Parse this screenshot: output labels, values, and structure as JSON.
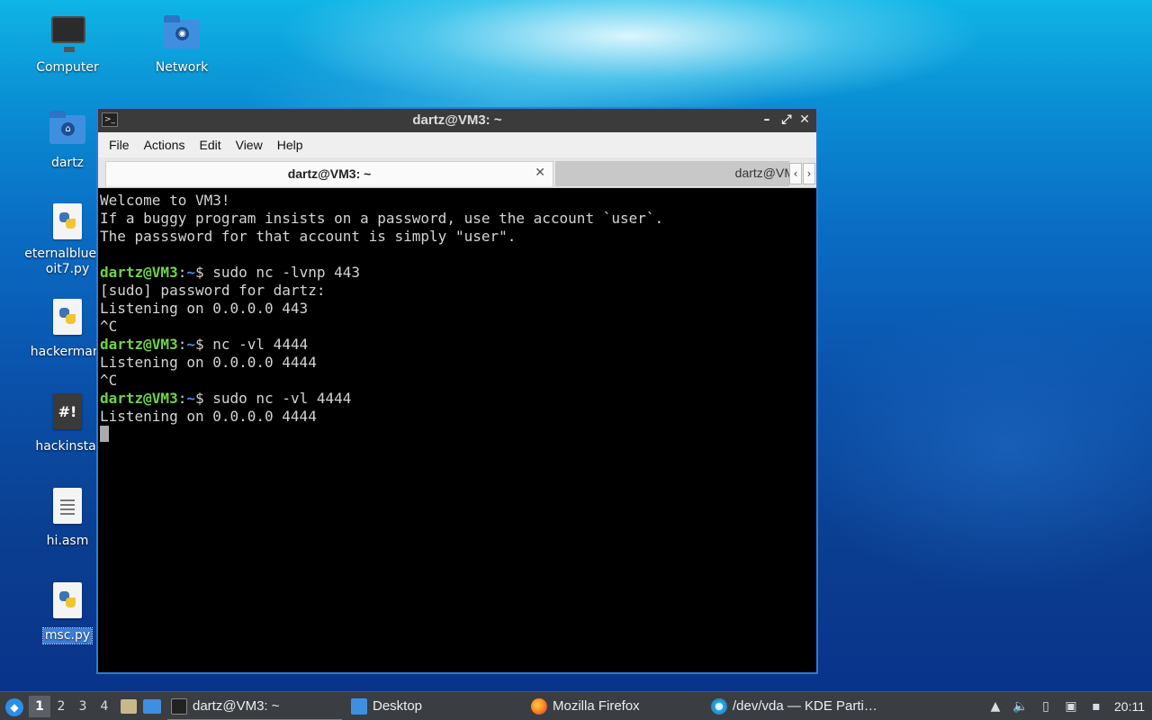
{
  "desktop": {
    "icons": [
      {
        "label": "Computer",
        "icon": "computer-icon"
      },
      {
        "label": "Network",
        "icon": "network-folder-icon"
      },
      {
        "label": "dartz",
        "icon": "home-folder-icon"
      },
      {
        "label": "eternalblue_e\noit7.py",
        "icon": "python-file-icon"
      },
      {
        "label": "hackerman.",
        "icon": "python-file-icon"
      },
      {
        "label": "hackinstal",
        "icon": "shell-script-icon"
      },
      {
        "label": "hi.asm",
        "icon": "text-file-icon"
      },
      {
        "label": "msc.py",
        "icon": "python-file-icon"
      }
    ]
  },
  "window": {
    "title": "dartz@VM3: ~",
    "menu": [
      "File",
      "Actions",
      "Edit",
      "View",
      "Help"
    ],
    "tabs": [
      {
        "label": "dartz@VM3: ~",
        "active": true
      },
      {
        "label": "dartz@VM",
        "active": false
      }
    ],
    "terminal": {
      "lines": [
        {
          "text": "Welcome to VM3!"
        },
        {
          "text": "If a buggy program insists on a password, use the account `user`."
        },
        {
          "text": "The passsword for that account is simply \"user\"."
        },
        {
          "text": ""
        },
        {
          "user": "dartz@VM3",
          "path": "~",
          "cmd": "sudo nc -lvnp 443"
        },
        {
          "text": "[sudo] password for dartz:"
        },
        {
          "text": "Listening on 0.0.0.0 443"
        },
        {
          "text": "^C"
        },
        {
          "user": "dartz@VM3",
          "path": "~",
          "cmd": "nc -vl 4444"
        },
        {
          "text": "Listening on 0.0.0.0 4444"
        },
        {
          "text": "^C"
        },
        {
          "user": "dartz@VM3",
          "path": "~",
          "cmd": "sudo nc -vl 4444"
        },
        {
          "text": "Listening on 0.0.0.0 4444"
        }
      ]
    }
  },
  "taskbar": {
    "workspaces": [
      "1",
      "2",
      "3",
      "4"
    ],
    "tasks": [
      {
        "label": "dartz@VM3: ~",
        "icon": "terminal-icon",
        "active": true
      },
      {
        "label": "Desktop",
        "icon": "folder-icon",
        "active": false
      },
      {
        "label": "Mozilla Firefox",
        "icon": "firefox-icon",
        "active": false
      },
      {
        "label": "/dev/vda — KDE Parti…",
        "icon": "partition-manager-icon",
        "active": false
      }
    ],
    "clock": "20:11"
  }
}
